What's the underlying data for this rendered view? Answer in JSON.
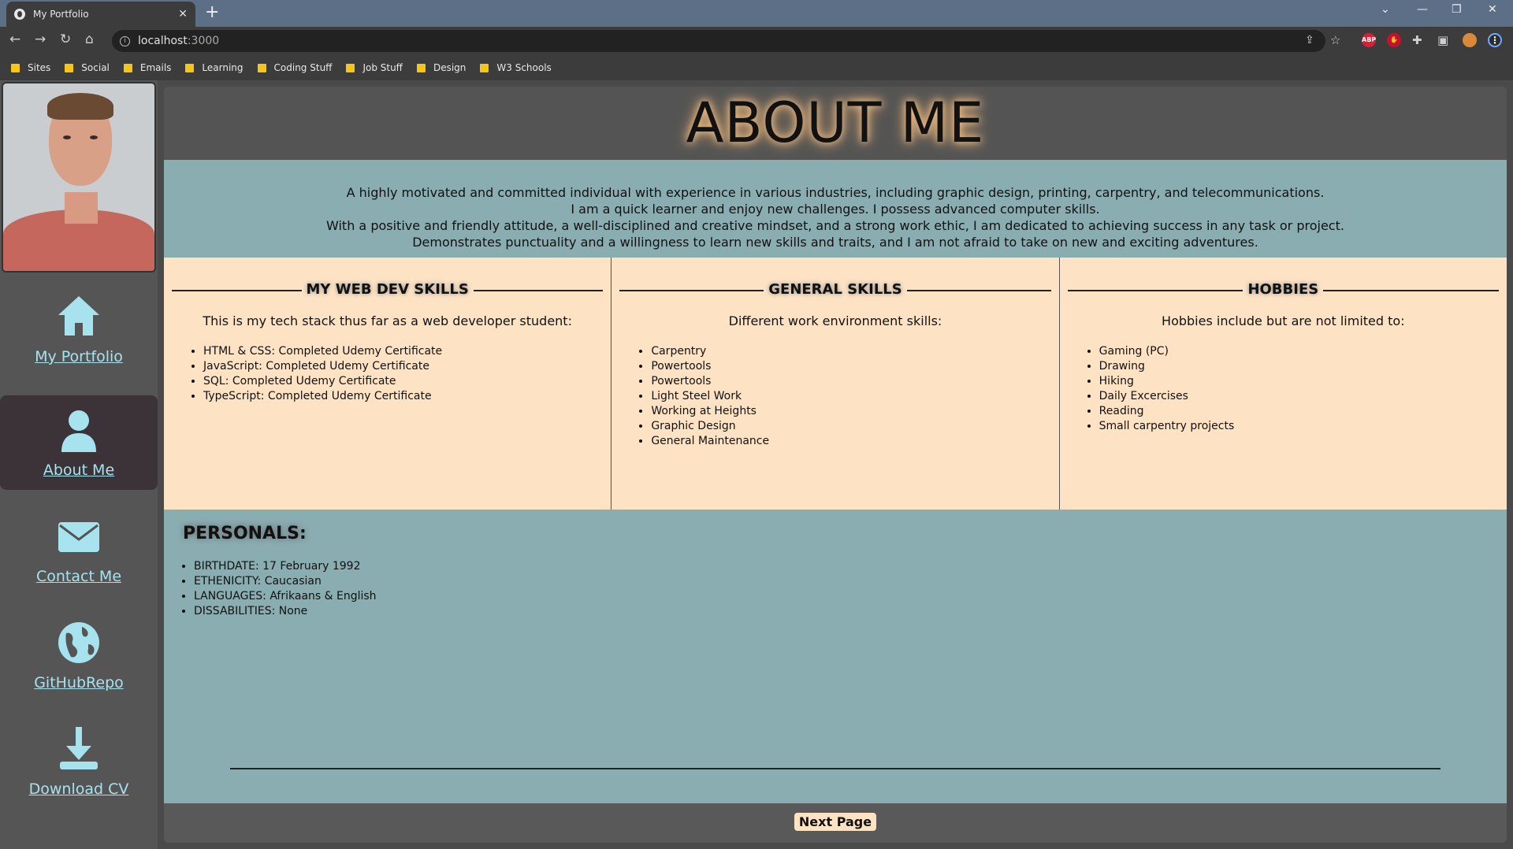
{
  "browser": {
    "tab_title": "My Portfolio",
    "url_host": "localhost",
    "url_port": ":3000",
    "bookmarks": [
      "Sites",
      "Social",
      "Emails",
      "Learning",
      "Coding Stuff",
      "Job Stuff",
      "Design",
      "W3 Schools"
    ],
    "extensions": [
      "ABP"
    ]
  },
  "sidebar": {
    "items": [
      {
        "label": "My Portfolio",
        "icon": "home-icon"
      },
      {
        "label": "About Me",
        "icon": "user-icon"
      },
      {
        "label": "Contact Me",
        "icon": "envelope-icon"
      },
      {
        "label": "GitHubRepo",
        "icon": "globe-icon"
      },
      {
        "label": "Download CV",
        "icon": "download-icon"
      }
    ],
    "accent": "#a6e3ef"
  },
  "header": {
    "title": "ABOUT ME"
  },
  "intro": {
    "lines": [
      "A highly motivated and committed individual with experience in various industries, including graphic design, printing, carpentry, and telecommunications.",
      "I am a quick learner and enjoy new challenges. I possess advanced computer skills.",
      "With a positive and friendly attitude, a well-disciplined and creative mindset, and a strong work ethic, I am dedicated to achieving success in any task or project.",
      "Demonstrates punctuality and a willingness to learn new skills and traits, and I am not afraid to take on new and exciting adventures."
    ]
  },
  "columns": [
    {
      "heading": "MY WEB DEV SKILLS",
      "sub": "This is my tech stack thus far as a web developer student:",
      "items": [
        "HTML & CSS: Completed Udemy Certificate",
        "JavaScript: Completed Udemy Certificate",
        "SQL: Completed Udemy Certificate",
        "TypeScript: Completed Udemy Certificate"
      ]
    },
    {
      "heading": "GENERAL SKILLS",
      "sub": "Different work environment skills:",
      "items": [
        "Carpentry",
        "Powertools",
        "Powertools",
        "Light Steel Work",
        "Working at Heights",
        "Graphic Design",
        "General Maintenance"
      ]
    },
    {
      "heading": "HOBBIES",
      "sub": "Hobbies include but are not limited to:",
      "items": [
        "Gaming (PC)",
        "Drawing",
        "Hiking",
        "Daily Excercises",
        "Reading",
        "Small carpentry projects"
      ]
    }
  ],
  "personals": {
    "heading": "PERSONALS:",
    "items": [
      "BIRTHDATE: 17 February 1992",
      "ETHENICITY: Caucasian",
      "LANGUAGES: Afrikaans & English",
      "DISSABILITIES: None"
    ]
  },
  "footer": {
    "next_label": "Next Page"
  },
  "colors": {
    "intro_bg": "#8aadb2",
    "skills_bg": "#fde3c4",
    "sidebar_bg": "#555555",
    "active_bg": "#3b3337"
  }
}
